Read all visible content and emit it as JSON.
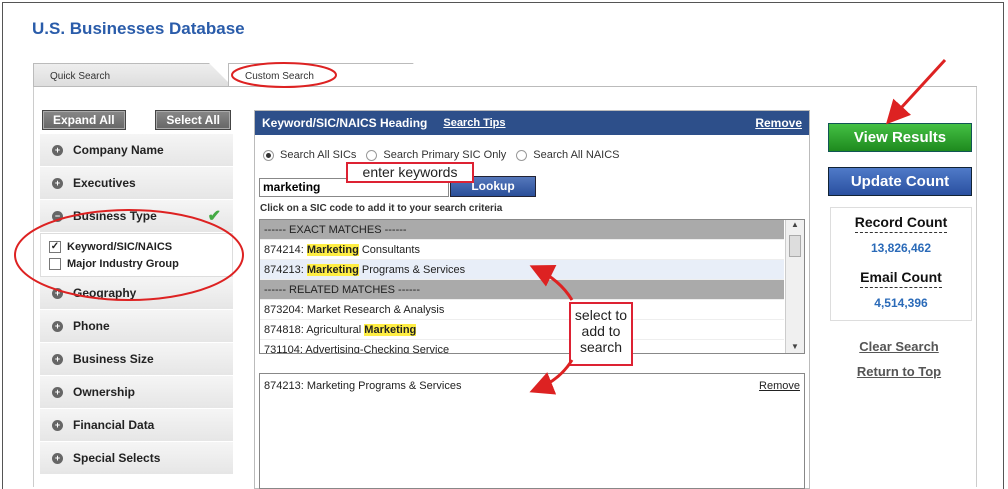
{
  "app_title": "U.S. Businesses Database",
  "tabs": {
    "quick": "Quick Search",
    "custom": "Custom Search"
  },
  "sidebar": {
    "expand_all": "Expand All",
    "select_all": "Select All",
    "items": [
      "Company Name",
      "Executives",
      "Business Type",
      "Geography",
      "Phone",
      "Business Size",
      "Ownership",
      "Financial Data",
      "Special Selects"
    ],
    "business_type_options": [
      {
        "label": "Keyword/SIC/NAICS",
        "checked": true
      },
      {
        "label": "Major Industry Group",
        "checked": false
      }
    ]
  },
  "keyword_panel": {
    "heading": "Keyword/SIC/NAICS Heading",
    "search_tips": "Search Tips",
    "remove": "Remove",
    "radios": [
      "Search All SICs",
      "Search Primary SIC Only",
      "Search All NAICS"
    ],
    "selected_radio": 0,
    "keyword_value": "marketing",
    "lookup_label": "Lookup",
    "hint": "Click on a SIC code to add it to your search criteria",
    "results": [
      {
        "type": "header",
        "text": "------ EXACT MATCHES ------"
      },
      {
        "code": "874214:",
        "highlight": "Marketing",
        "rest": " Consultants"
      },
      {
        "code": "874213:",
        "highlight": "Marketing",
        "rest": " Programs & Services"
      },
      {
        "type": "header",
        "text": "------ RELATED MATCHES ------"
      },
      {
        "code": "873204:",
        "highlight": "",
        "rest": " Market Research & Analysis"
      },
      {
        "code": "874818:",
        "highlight": "Marketing",
        "rest": " Agricultural ",
        "order": "rest-first"
      },
      {
        "code": "731104:",
        "highlight": "",
        "rest": " Advertising-Checking Service"
      }
    ],
    "selected": {
      "text": "874213: Marketing Programs & Services",
      "remove": "Remove"
    }
  },
  "callouts": {
    "enter_keywords": "enter keywords",
    "select_to_add": "select to add to search"
  },
  "right": {
    "view_results": "View Results",
    "update_count": "Update Count",
    "record_count_label": "Record Count",
    "record_count": "13,826,462",
    "email_count_label": "Email Count",
    "email_count": "4,514,396",
    "clear_search": "Clear Search",
    "return_to_top": "Return to Top"
  },
  "colors": {
    "accent": "#2a5caa",
    "header": "#2d4f8a",
    "green": "#2ea02e",
    "annotation": "#dd2222"
  }
}
